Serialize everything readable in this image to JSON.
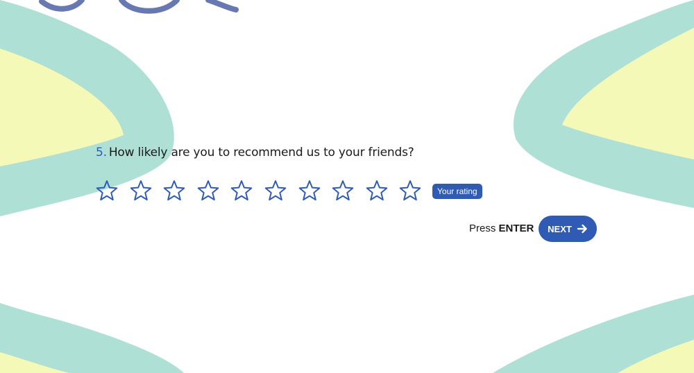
{
  "question": {
    "number": "5.",
    "text": "How likely are you to recommend us to your friends?"
  },
  "rating": {
    "max": 10,
    "selected": 0,
    "icon": "star-outline-icon",
    "label": "Your rating"
  },
  "hint": {
    "prefix": "Press",
    "key": "ENTER"
  },
  "next_button": {
    "label": "NEXT",
    "icon": "arrow-right-icon"
  },
  "colors": {
    "accent": "#2f5bb5",
    "teal": "#aee0d6",
    "yellow": "#f4f9b8",
    "decor_stroke": "#6878b0"
  }
}
